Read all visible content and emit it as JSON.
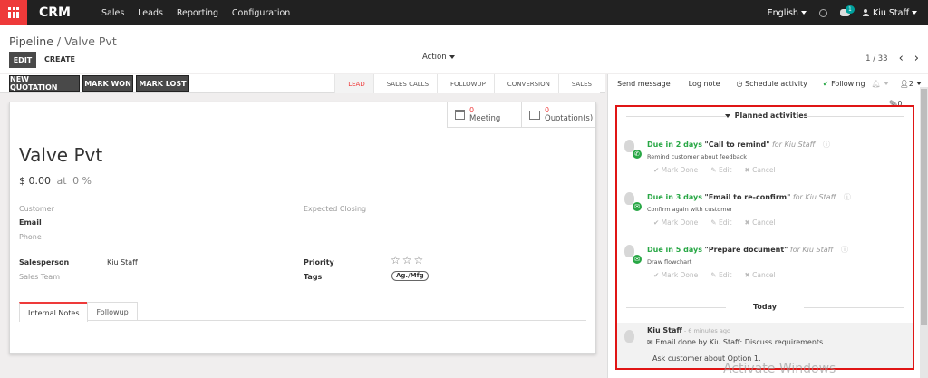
{
  "nav": {
    "brand": "CRM",
    "menu": [
      "Sales",
      "Leads",
      "Reporting",
      "Configuration"
    ],
    "language": "English",
    "messages_badge": "1",
    "user": "Kiu Staff"
  },
  "control": {
    "breadcrumb_parent": "Pipeline",
    "breadcrumb_sep": "/",
    "breadcrumb_current": "Valve Pvt",
    "edit_label": "EDIT",
    "create_label": "CREATE",
    "action_label": "Action",
    "pager": "1 / 33"
  },
  "statusbar": {
    "buttons": [
      "NEW QUOTATION",
      "MARK WON",
      "MARK LOST"
    ],
    "stages": [
      "LEAD",
      "SALES CALLS",
      "FOLLOWUP",
      "CONVERSION",
      "SALES"
    ],
    "active_stage": "LEAD"
  },
  "smart_buttons": [
    {
      "count": "0",
      "label": "Meeting",
      "icon": "calendar-icon"
    },
    {
      "count": "0",
      "label": "Quotation(s)",
      "icon": "edit-icon"
    }
  ],
  "form": {
    "name": "Valve Pvt",
    "revenue": "$ 0.00",
    "probability_prefix": "at",
    "probability": "0 %",
    "customer_label": "Customer",
    "email_label": "Email",
    "phone_label": "Phone",
    "expected_closing_label": "Expected Closing",
    "salesperson_label": "Salesperson",
    "salesperson_value": "Kiu Staff",
    "sales_team_label": "Sales Team",
    "priority_label": "Priority",
    "priority_stars": "☆☆☆",
    "tags_label": "Tags",
    "tag_value": "Ag./Mfg",
    "tabs": [
      "Internal Notes",
      "Followup"
    ]
  },
  "chatter": {
    "send_message": "Send message",
    "log_note": "Log note",
    "schedule_activity": "Schedule activity",
    "following": "Following",
    "followers_count": "2",
    "attachments_count": "0",
    "planned_title": "Planned activities",
    "activities": [
      {
        "due": "Due in 2 days",
        "summary": "\"Call to remind\"",
        "for": "for Kiu Staff",
        "note": "Remind customer about feedback",
        "icon": "phone-icon",
        "glyph": "✆"
      },
      {
        "due": "Due in 3 days",
        "summary": "\"Email to re-confirm\"",
        "for": "for Kiu Staff",
        "note": "Confirm again with customer",
        "icon": "envelope-icon",
        "glyph": "✉"
      },
      {
        "due": "Due in 5 days",
        "summary": "\"Prepare document\"",
        "for": "for Kiu Staff",
        "note": "Draw flowchart",
        "icon": "envelope-icon",
        "glyph": "✉"
      }
    ],
    "activity_actions": [
      "✔ Mark Done",
      "✎ Edit",
      "✖ Cancel"
    ],
    "today_label": "Today",
    "message": {
      "author": "Kiu Staff",
      "ago": "- 6 minutes ago",
      "body": "✉ Email done by Kiu Staff: Discuss requirements",
      "body2": "Ask customer about Option 1."
    }
  },
  "watermark": "Activate Windows",
  "colors": {
    "topbar": "#212121",
    "apps": "#ee3a3a",
    "due": "#28a745",
    "highlight": "#e01515"
  }
}
